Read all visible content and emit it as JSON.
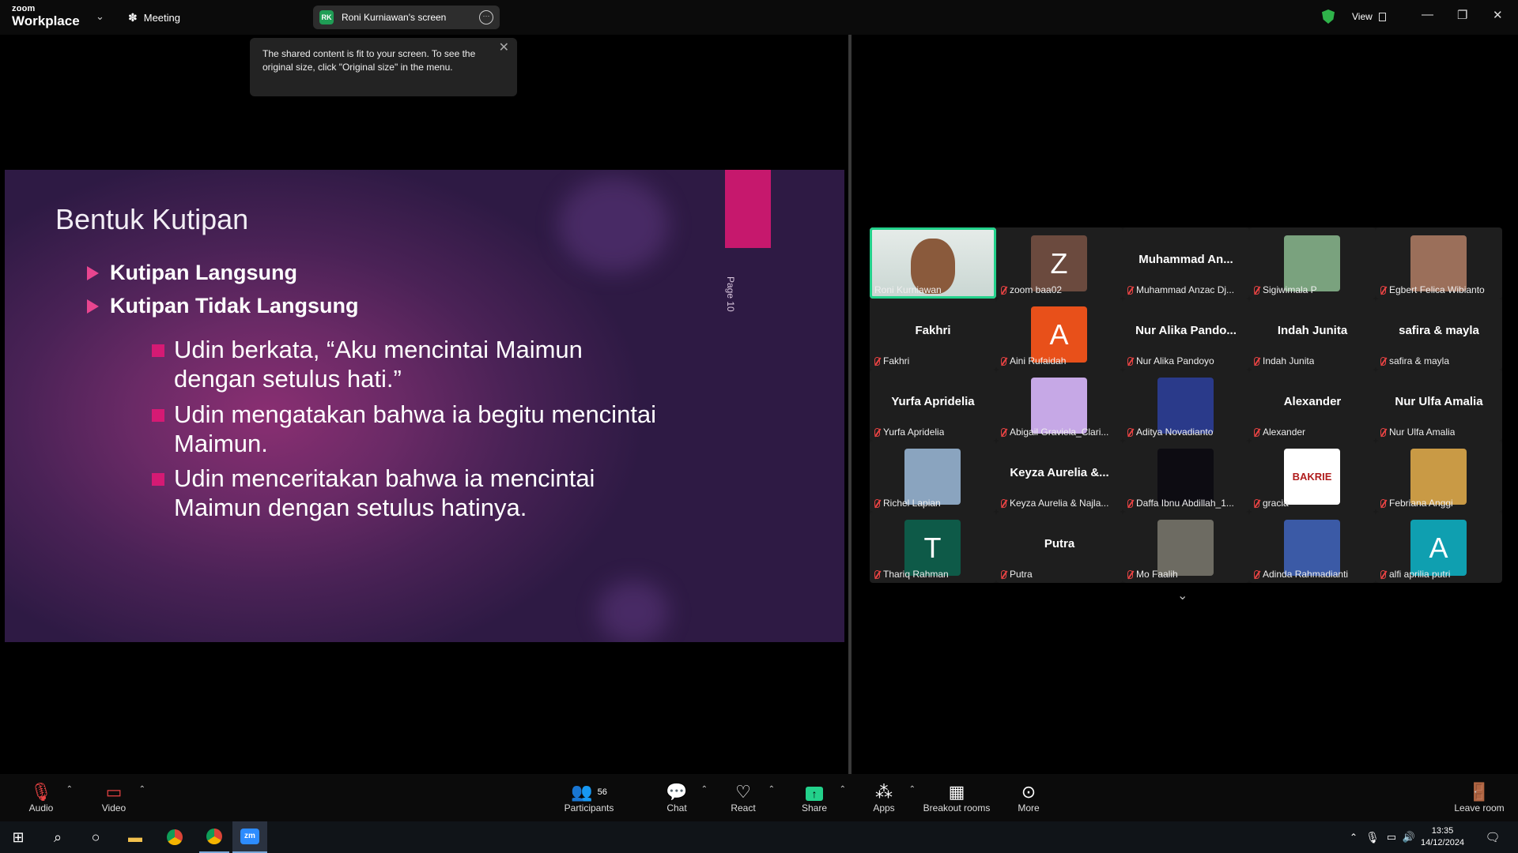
{
  "app": {
    "logo_top": "zoom",
    "logo_bottom": "Workplace",
    "meeting_label": "Meeting",
    "share_badge": "RK",
    "share_title": "Roni Kurniawan's screen",
    "view_label": "View"
  },
  "tooltip": {
    "text": "The shared content is fit to your screen. To see the original size, click \"Original size\" in the menu."
  },
  "slide": {
    "title": "Bentuk Kutipan",
    "page_label": "Page 10",
    "level1": [
      "Kutipan Langsung",
      "Kutipan Tidak Langsung"
    ],
    "level2": [
      "Udin berkata, “Aku mencintai Maimun dengan setulus hati.”",
      "Udin mengatakan bahwa ia begitu mencintai Maimun.",
      "Udin menceritakan bahwa ia mencintai Maimun dengan setulus hatinya."
    ],
    "accent_color": "#c6186d"
  },
  "participants": [
    {
      "name": "Roni Kurniawan",
      "display": "",
      "kind": "video",
      "color": "#c9d6d2"
    },
    {
      "name": "zoom baa02",
      "display": "Z",
      "kind": "letter",
      "color": "#6b4a3e"
    },
    {
      "name": "Muhammad Anzac Dj...",
      "display": "Muhammad An...",
      "kind": "name"
    },
    {
      "name": "Sigiwimala P",
      "display": "",
      "kind": "photo",
      "color": "#7aa27e"
    },
    {
      "name": "Egbert Felica Wibianto",
      "display": "",
      "kind": "photo",
      "color": "#9b6f5a"
    },
    {
      "name": "Fakhri",
      "display": "Fakhri",
      "kind": "name"
    },
    {
      "name": "Aini Rufaidah",
      "display": "A",
      "kind": "letter",
      "color": "#e8501a"
    },
    {
      "name": "Nur Alika Pandoyo",
      "display": "Nur Alika Pando...",
      "kind": "name"
    },
    {
      "name": "Indah Junita",
      "display": "Indah Junita",
      "kind": "name"
    },
    {
      "name": "safira & mayla",
      "display": "safira & mayla",
      "kind": "name"
    },
    {
      "name": "Yurfa Aprideliа",
      "display": "Yurfa Aprideliа",
      "kind": "name"
    },
    {
      "name": "Abigail Graviela_Clari...",
      "display": "",
      "kind": "photo",
      "color": "#c6a8e6"
    },
    {
      "name": "Aditya Novadianto",
      "display": "",
      "kind": "photo",
      "color": "#2a3a8a"
    },
    {
      "name": "Alexander",
      "display": "Alexander",
      "kind": "name"
    },
    {
      "name": "Nur Ulfa Amalia",
      "display": "Nur Ulfa Amalia",
      "kind": "name"
    },
    {
      "name": "Richel Lapian",
      "display": "",
      "kind": "photo",
      "color": "#8aa4bf"
    },
    {
      "name": "Keyza Aurelia & Najla...",
      "display": "Keyza Aurelia &...",
      "kind": "name"
    },
    {
      "name": "Daffa Ibnu Abdillah_1...",
      "display": "",
      "kind": "photo",
      "color": "#0d0c12"
    },
    {
      "name": "gracia",
      "display": "BAKRIE",
      "kind": "logo",
      "color": "#ffffff"
    },
    {
      "name": "Febriana Anggi",
      "display": "",
      "kind": "photo",
      "color": "#c99a45"
    },
    {
      "name": "Thariq Rahman",
      "display": "T",
      "kind": "letter",
      "color": "#0e5a48"
    },
    {
      "name": "Putra",
      "display": "Putra",
      "kind": "name"
    },
    {
      "name": "Mo Faalih",
      "display": "",
      "kind": "photo",
      "color": "#6d6b62"
    },
    {
      "name": "Adinda Rahmadianti",
      "display": "",
      "kind": "photo",
      "color": "#3b5aa6"
    },
    {
      "name": "alfi aprilia putri",
      "display": "A",
      "kind": "letter",
      "color": "#0f9fb0"
    }
  ],
  "toolbar": {
    "audio": "Audio",
    "video": "Video",
    "participants": "Participants",
    "participants_count": "56",
    "chat": "Chat",
    "react": "React",
    "share": "Share",
    "apps": "Apps",
    "breakout": "Breakout rooms",
    "more": "More",
    "leave": "Leave room"
  },
  "taskbar": {
    "time": "13:35",
    "date": "14/12/2024"
  }
}
